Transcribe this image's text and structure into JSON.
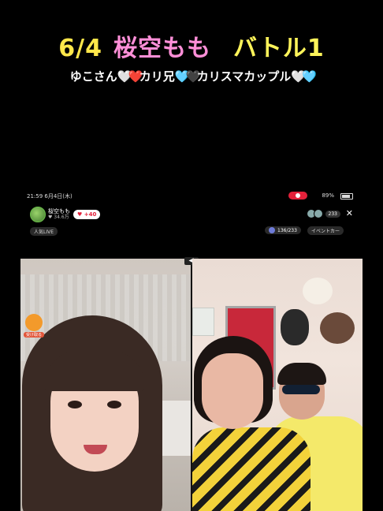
{
  "header": {
    "date": "6/4",
    "streamer": "桜空もも",
    "event": "バトル1"
  },
  "subtitle": {
    "part1": "ゆこさん",
    "part2": "カリ兄",
    "part3": "カリスマカップル",
    "heart_white": "🤍",
    "heart_red": "❤️",
    "heart_blue": "🩵",
    "heart_black": "🖤"
  },
  "status_bar": {
    "time": "21:59  6月4日(木)",
    "signal": "89%"
  },
  "host": {
    "name": "桜空もも",
    "sub": "♥ 34.6万",
    "likes": "+40"
  },
  "viewers": {
    "count": "233"
  },
  "tags": {
    "popular": "人気LIVE",
    "rank": "136/233",
    "event": "イベントカー"
  },
  "gift_badge": {
    "label": "受け取る"
  },
  "colors": {
    "date": "#ffe74a",
    "streamer": "#ff8fd8",
    "event": "#fff45a",
    "rec": "#e3213a"
  },
  "icons": {
    "close": "close-icon",
    "mute": "mute-icon",
    "gift": "gift-icon"
  }
}
